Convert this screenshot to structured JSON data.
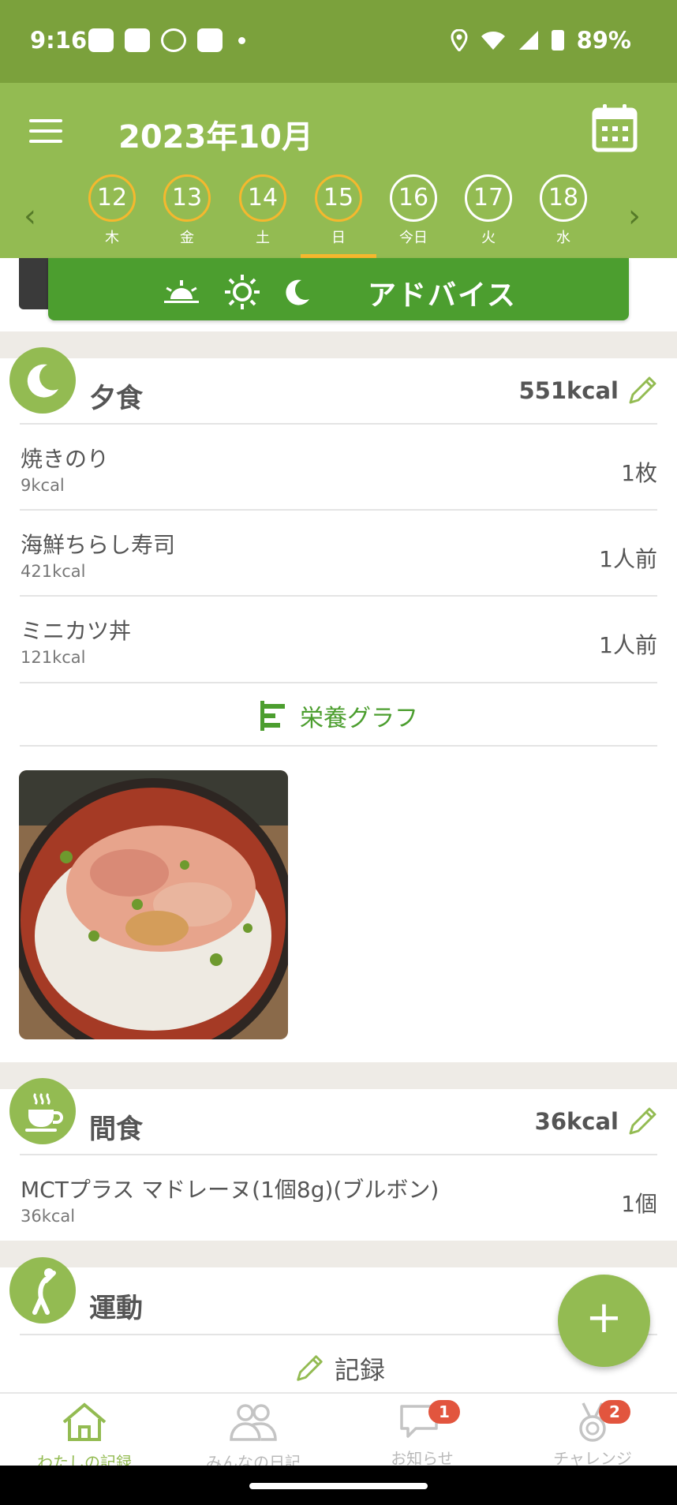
{
  "status_bar": {
    "time": "9:16",
    "battery": "89%"
  },
  "header": {
    "month_title": "2023年10月",
    "days": [
      {
        "num": "12",
        "weekday": "木"
      },
      {
        "num": "13",
        "weekday": "金"
      },
      {
        "num": "14",
        "weekday": "土"
      },
      {
        "num": "15",
        "weekday": "日"
      },
      {
        "num": "16",
        "weekday": "今日"
      },
      {
        "num": "17",
        "weekday": "火"
      },
      {
        "num": "18",
        "weekday": "水"
      }
    ]
  },
  "advice": {
    "label": "アドバイス"
  },
  "dinner": {
    "title": "夕食",
    "total_kcal": "551kcal",
    "items": [
      {
        "name": "焼きのり",
        "kcal": "9kcal",
        "qty": "1枚"
      },
      {
        "name": "海鮮ちらし寿司",
        "kcal": "421kcal",
        "qty": "1人前"
      },
      {
        "name": "ミニカツ丼",
        "kcal": "121kcal",
        "qty": "1人前"
      }
    ],
    "nutrition_link": "栄養グラフ"
  },
  "snack": {
    "title": "間食",
    "total_kcal": "36kcal",
    "items": [
      {
        "name": "MCTプラス マドレーヌ(1個8g)(ブルボン)",
        "kcal": "36kcal",
        "qty": "1個"
      }
    ]
  },
  "exercise": {
    "title": "運動",
    "record_label": "記録"
  },
  "bottom_nav": {
    "items": [
      {
        "label": "わたしの記録"
      },
      {
        "label": "みんなの日記"
      },
      {
        "label": "お知らせ",
        "badge": "1"
      },
      {
        "label": "チャレンジ",
        "badge": "2"
      }
    ]
  },
  "colors": {
    "header": "#93bb52",
    "status": "#7ba13c",
    "accent": "#4c9e2f",
    "highlight": "#f5b82e",
    "badge": "#e2553e"
  }
}
